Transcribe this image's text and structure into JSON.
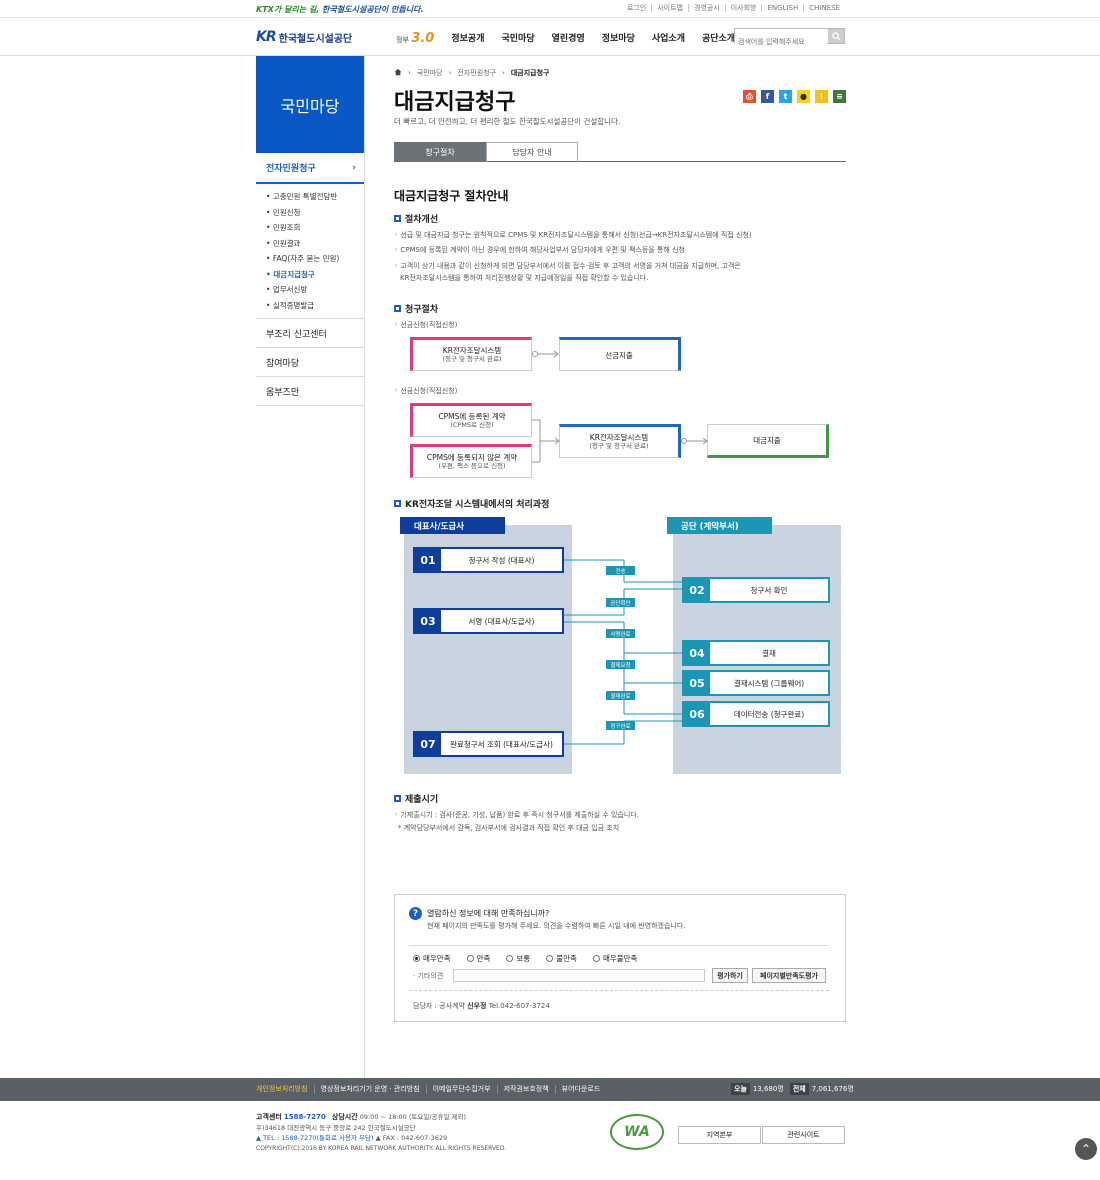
{
  "topbar": {
    "slogan_a": "KTX가 달리는 길,",
    "slogan_b": "한국철도시설공단이 만듭니다.",
    "links": [
      "로그인",
      "사이트맵",
      "경영공시",
      "이사회방",
      "ENGLISH",
      "CHINESE"
    ]
  },
  "header": {
    "logo_mark": "KR",
    "logo_name": "한국철도시설공단",
    "gov_label": "정부",
    "gov_num": "3.0",
    "gnb": [
      "정보공개",
      "국민마당",
      "열린경영",
      "정보마당",
      "사업소개",
      "공단소개"
    ],
    "search_placeholder": "검색어를 입력해주세요"
  },
  "lnb": {
    "title": "국민마당",
    "active": "전자민원청구",
    "sub": [
      "고충민원 특별전담반",
      "민원신청",
      "민원조회",
      "민원결과",
      "FAQ(자주 묻는 민원)",
      "대금지급청구",
      "업무서신방",
      "실적증명발급"
    ],
    "others": [
      "부조리 신고센터",
      "참여마당",
      "옴부즈만"
    ]
  },
  "breadcrumb": [
    "국민마당",
    "전자민원청구",
    "대금지급청구"
  ],
  "page": {
    "title": "대금지급청구",
    "desc": "더 빠르고, 더 안전하고, 더 편리한 철도 한국철도시설공단이 건설합니다.",
    "tabs": [
      "청구절차",
      "담당자 안내"
    ]
  },
  "guide": {
    "heading": "대금지급청구 절차안내",
    "s1": {
      "title": "절차개선",
      "items": [
        "선급 및 대금지급 청구는 원칙적으로 CPMS 및 KR전자조달시스템을 통해서 신청(선급→KR전자조달시스템에 직접 신청)",
        "CPMS에 등록된 계약이 아닌 경우에 한하여 해당사업부서 담당자에게 우편 및 팩스등을 통해 신청",
        "고객이 상기 내용과 같이 신청하게 되면 담당부서에서 이를 접수·검토 후 고객의 서명을 거쳐 대금을 지급하며, 고객은",
        "KR전자조달시스템을 통하여 처리진행상황 및 지급예정일을 직접 확인할 수 있습니다."
      ]
    },
    "s2": {
      "title": "청구절차",
      "lab1": "선금신청(직접신청)",
      "lab2": "선금신청(직접신청)",
      "f1a": "KR전자조달시스템",
      "f1b": "(청구 및 청구서 완료)",
      "f1c": "선금지출",
      "f2a": "CPMS에 등록된 계약",
      "f2b": "(CPMS로 신청)",
      "f2c": "CPMS에 등록되지 않은 계약",
      "f2d": "(우편, 팩스 등으로 신청)",
      "f2e": "KR전자조달시스템",
      "f2f": "(청구 및 청구서 완료)",
      "f2g": "대금지출"
    },
    "s3": {
      "title": "KR전자조달 시스템내에서의 처리과정",
      "left": "대표사/도급사",
      "right": "공단 (계약부서)",
      "steps": [
        {
          "n": "01",
          "t": "청구서 작성 (대표사)"
        },
        {
          "n": "02",
          "t": "청구서 확인"
        },
        {
          "n": "03",
          "t": "서명 (대표사/도급사)"
        },
        {
          "n": "04",
          "t": "결재"
        },
        {
          "n": "05",
          "t": "결재시스템 (그룹웨어)"
        },
        {
          "n": "06",
          "t": "데이터전송 (청구완료)"
        },
        {
          "n": "07",
          "t": "완료청구서 조회 (대표사/도급사)"
        }
      ],
      "tags": [
        "전송",
        "공단확인",
        "서명완료",
        "결재요청",
        "결재완료",
        "청구완료"
      ]
    },
    "s4": {
      "title": "제출시기",
      "items": [
        "기제출시기 : 검사(준공, 기성, 납품) 완료 후 즉시 청구서를 제출하실 수 있습니다.",
        "* 계약담당부서에서 감독, 검사부서에 검사결과 직접 확인 후 대금 입금 조치"
      ]
    }
  },
  "survey": {
    "q": "열람하신 정보에 대해 만족하십니까?",
    "sub": "현재 페이지의 만족도를 평가해 주세요. 의견을 수렴하여 빠른 시일 내에 반영하겠습니다.",
    "options": [
      "매우만족",
      "만족",
      "보통",
      "불만족",
      "매우불만족"
    ],
    "etc": "· 기타의견",
    "btn1": "평가하기",
    "btn2": "페이지별만족도평가",
    "mgr_label": "담당자 : 공사계약",
    "mgr_name": "신우정",
    "mgr_tel": "Tel.042-607-3724"
  },
  "footer": {
    "links": [
      "개인정보처리방침",
      "영상정보처리기기 운영 · 관리방침",
      "이메일무단수집거부",
      "저작권보호정책",
      "뷰어다운로드"
    ],
    "today_label": "오늘",
    "today": "13,680명",
    "total_label": "전체",
    "total": "7,061,676명",
    "cs_label": "고객센터",
    "cs_tel": "1588-7270",
    "hours_label": "상담시간",
    "hours": "09:00 ~ 18:00 (토요일/공휴일 제외)",
    "addr": "우)34618 대전광역시 동구 중앙로 242 한국철도시설공단",
    "tel": "▲ TEL : 1588-7270(통화료 사용자 부담)",
    "fax": "▲ FAX : 042-607-3629",
    "copy": "COPYRIGHT(C) 2016 BY KOREA RAIL NETWORK AUTHORITY. ALL RIGHTS RESERVED.",
    "wa": "WA",
    "btn1": "지역본부",
    "btn2": "관련사이트"
  }
}
